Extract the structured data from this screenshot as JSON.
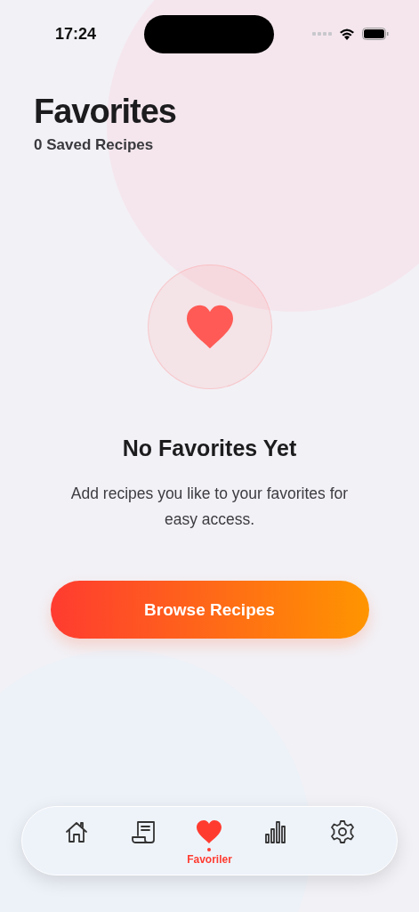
{
  "status_bar": {
    "time": "17:24"
  },
  "header": {
    "title": "Favorites",
    "subtitle": "0 Saved Recipes"
  },
  "empty_state": {
    "title": "No Favorites Yet",
    "message": "Add recipes you like to your favorites for easy access.",
    "button": "Browse Recipes"
  },
  "tab_bar": [
    {
      "kind": "home",
      "selected": false
    },
    {
      "kind": "recipes",
      "selected": false
    },
    {
      "kind": "favorites",
      "selected": true,
      "label": "Favoriler"
    },
    {
      "kind": "stats",
      "selected": false
    },
    {
      "kind": "settings",
      "selected": false
    }
  ]
}
